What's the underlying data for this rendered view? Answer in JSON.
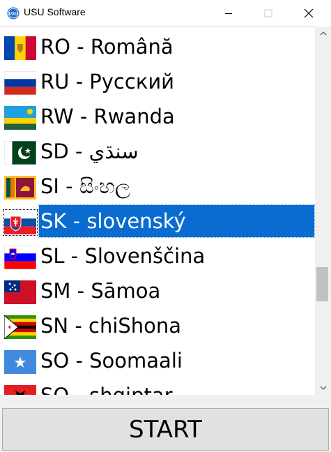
{
  "window": {
    "title": "USU Software",
    "app_icon": "usu-logo-icon",
    "icon_text": "USU"
  },
  "controls": {
    "minimize_icon": "minimize-icon",
    "maximize_icon": "maximize-icon",
    "close_icon": "close-icon"
  },
  "languages": [
    {
      "label": "RO - Română",
      "flag": "moldova-flag-icon"
    },
    {
      "label": "RU - Русский",
      "flag": "russia-flag-icon"
    },
    {
      "label": "RW - Rwanda",
      "flag": "rwanda-flag-icon"
    },
    {
      "label": "SD - سنڌي",
      "flag": "pakistan-flag-icon"
    },
    {
      "label": "SI - සිංහල",
      "flag": "sri-lanka-flag-icon"
    },
    {
      "label": "SK - slovenský",
      "flag": "slovakia-flag-icon",
      "selected": true
    },
    {
      "label": "SL - Slovenščina",
      "flag": "slovenia-flag-icon"
    },
    {
      "label": "SM - Sāmoa",
      "flag": "samoa-flag-icon"
    },
    {
      "label": "SN - chiShona",
      "flag": "zimbabwe-flag-icon"
    },
    {
      "label": "SO - Soomaali",
      "flag": "somalia-flag-icon"
    },
    {
      "label": "SQ - shqiptar",
      "flag": "albania-flag-icon"
    }
  ],
  "scroll": {
    "position_fraction": 0.74,
    "visible_fraction": 0.1
  },
  "start_button": {
    "label": "START"
  },
  "colors": {
    "selection": "#0a6cd1",
    "selection_text": "#ffffff"
  }
}
